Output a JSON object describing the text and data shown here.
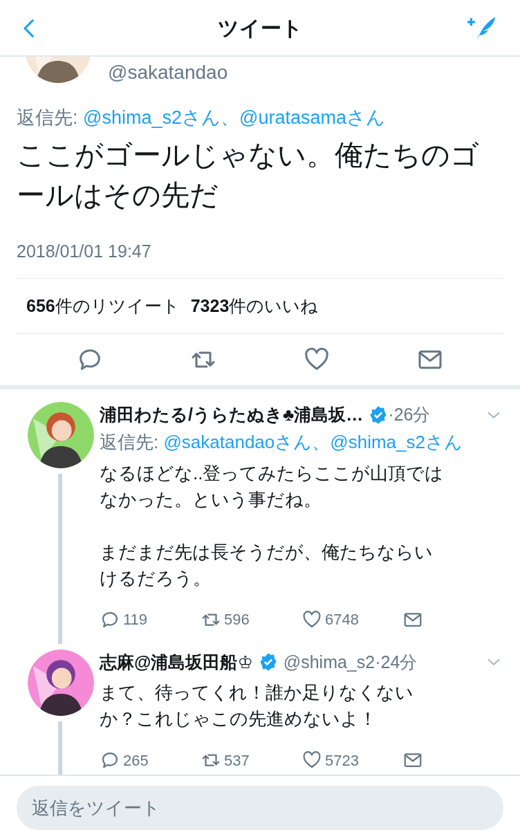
{
  "header": {
    "title": "ツイート"
  },
  "tweet": {
    "handle": "@sakatandao",
    "reply_to_label": "返信先:",
    "reply_to": [
      "@shima_s2さん、",
      "@uratasamaさん"
    ],
    "text": "ここがゴールじゃない。俺たちのゴールはその先だ",
    "timestamp": "2018/01/01 19:47",
    "retweet_count": "656",
    "retweet_label": "件のリツイート",
    "like_count": "7323",
    "like_label": "件のいいね"
  },
  "replies": [
    {
      "name": "浦田わたる/うらたぬき♣浦島坂…",
      "verified": true,
      "time": "·26分",
      "reply_to_label": "返信先:",
      "reply_to": [
        "@sakatandaoさん、",
        "@shima_s2さん"
      ],
      "text": [
        "なるほどな..登ってみたらここが山頂ではなかった。という事だね。",
        "まだまだ先は長そうだが、俺たちならいけるだろう。"
      ],
      "replies": "119",
      "retweets": "596",
      "likes": "6748"
    },
    {
      "name": "志麻@浦島坂田船♔",
      "verified": true,
      "handle": "@shima_s2",
      "time": "·24分",
      "text": [
        "まて、待ってくれ！誰か足りなくないか？これじゃこの先進めないよ！"
      ],
      "replies": "265",
      "retweets": "537",
      "likes": "5723"
    }
  ],
  "composer": {
    "placeholder": "返信をツイート"
  }
}
